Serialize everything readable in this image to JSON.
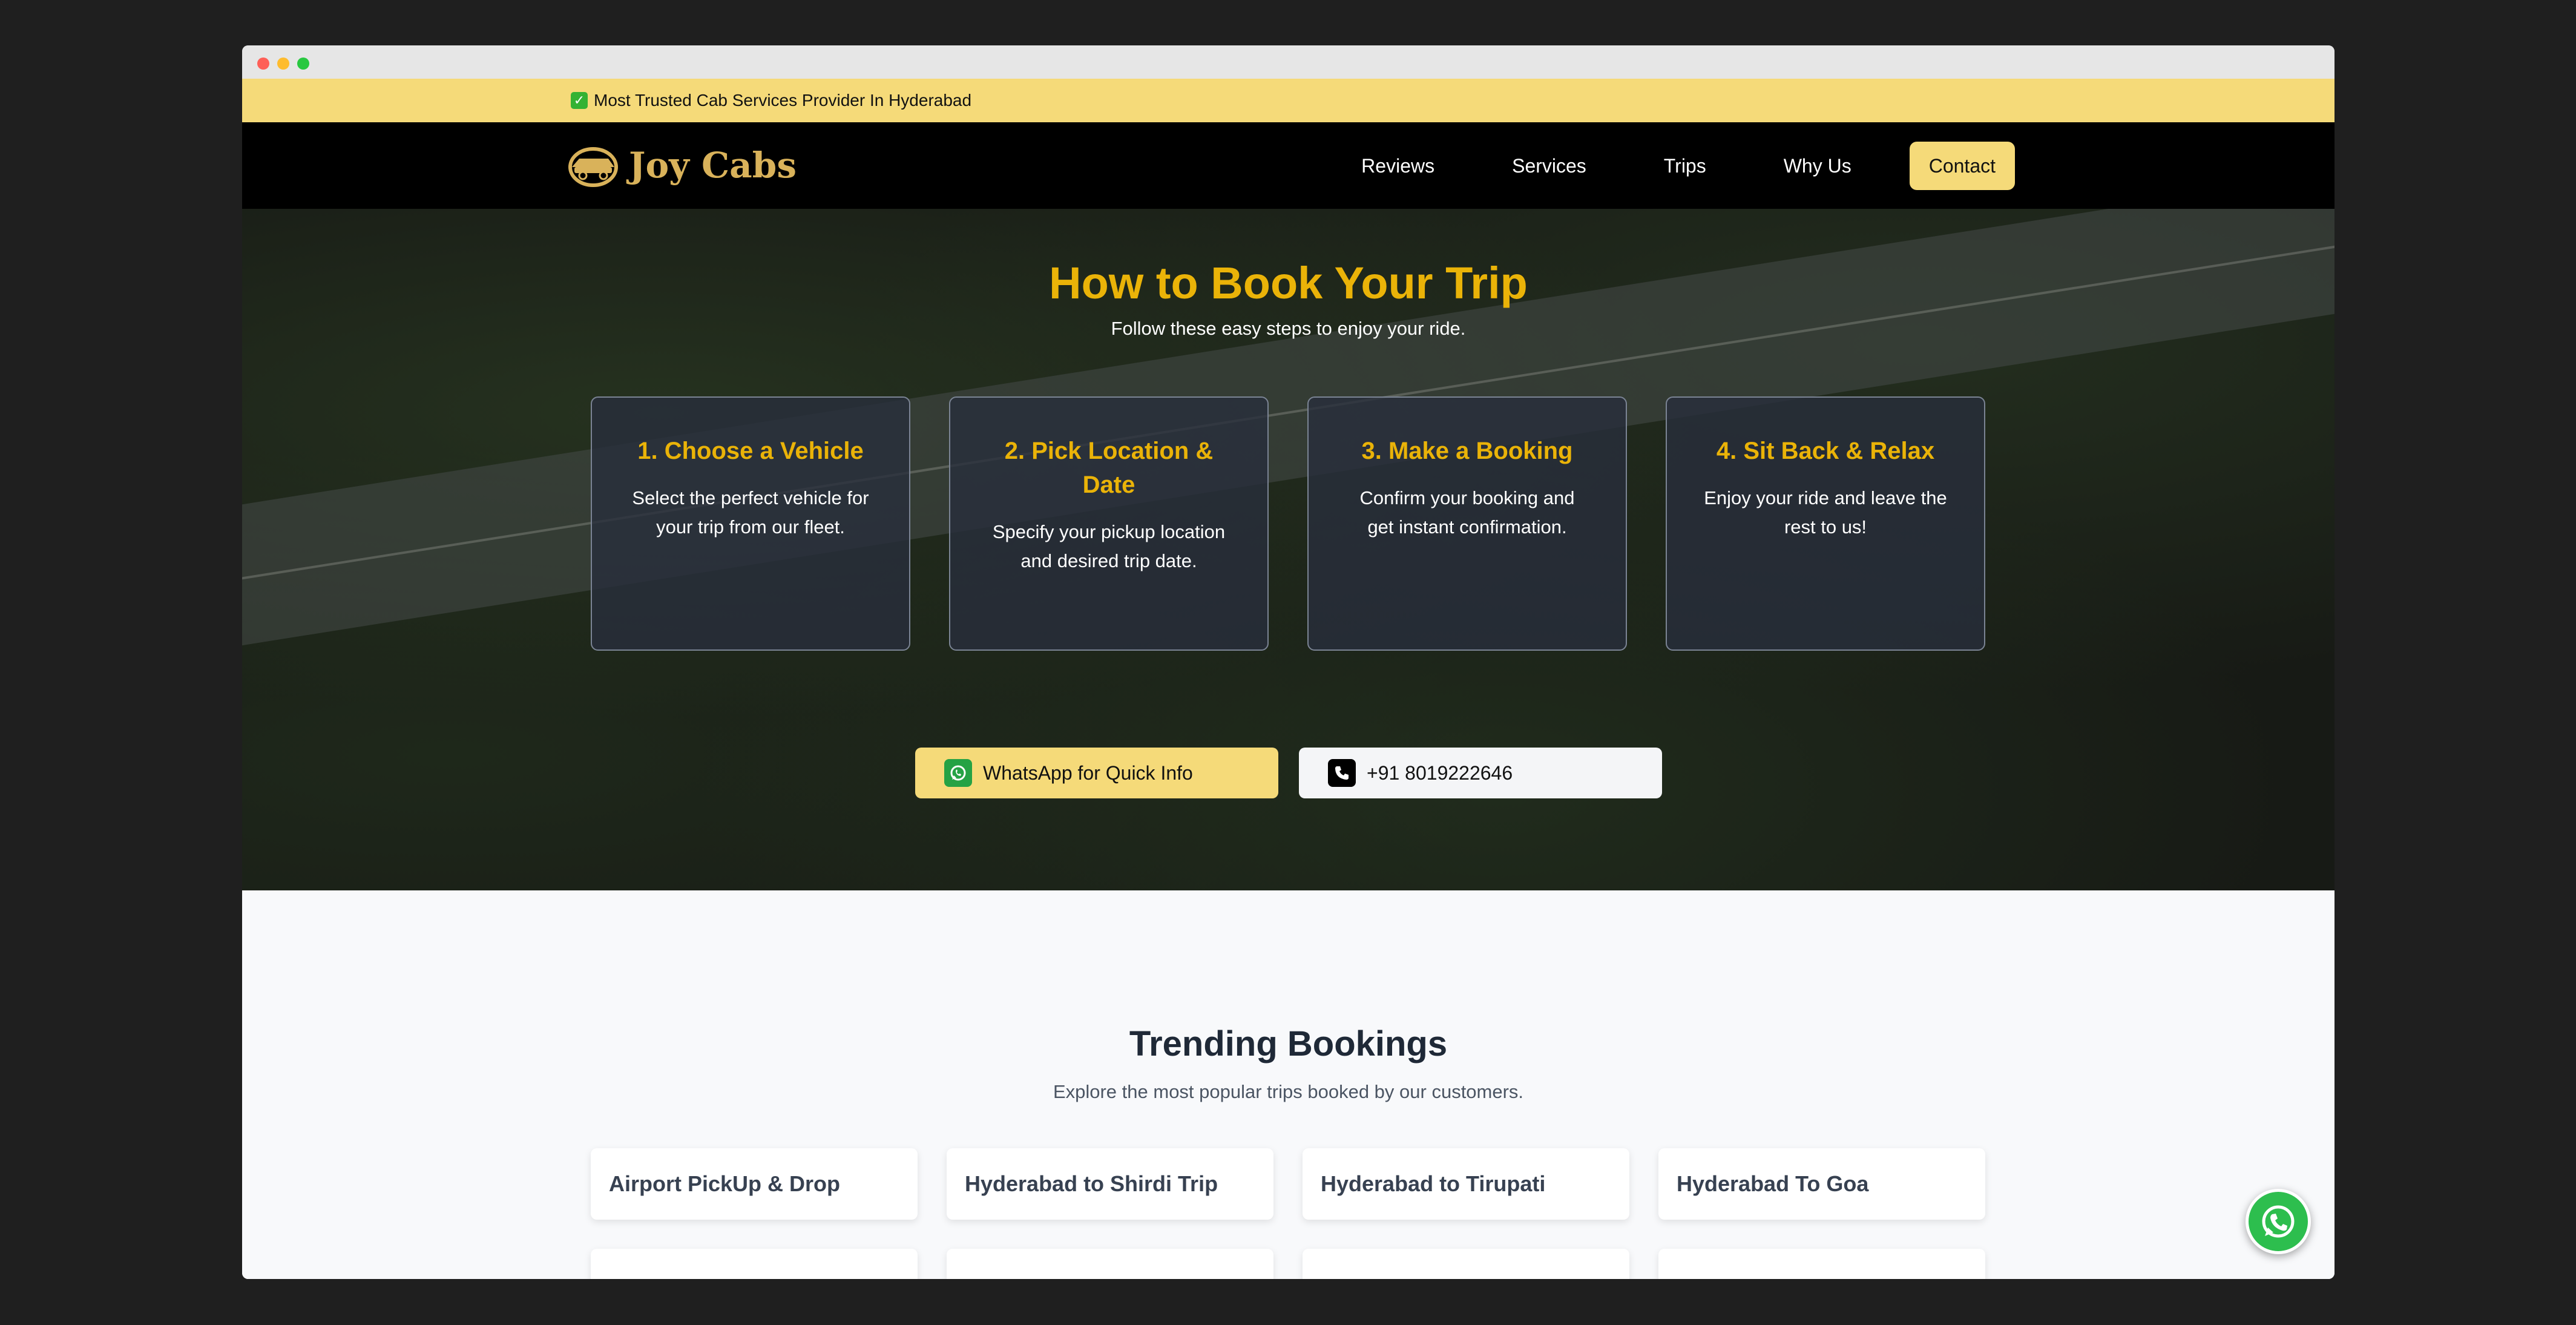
{
  "topbar": {
    "check_icon": "check-icon",
    "text": "Most Trusted Cab Services Provider In Hyderabad"
  },
  "brand": {
    "name": "Joy Cabs",
    "color": "#d9b25a"
  },
  "nav": {
    "links": [
      "Reviews",
      "Services",
      "Trips",
      "Why Us"
    ],
    "contact": "Contact"
  },
  "hero": {
    "title": "How to Book Your Trip",
    "subtitle": "Follow these easy steps to enjoy your ride.",
    "steps": [
      {
        "title": "1. Choose a Vehicle",
        "desc": "Select the perfect vehicle for your trip from our fleet."
      },
      {
        "title": "2. Pick Location & Date",
        "desc": "Specify your pickup location and desired trip date."
      },
      {
        "title": "3. Make a Booking",
        "desc": "Confirm your booking and get instant confirmation."
      },
      {
        "title": "4. Sit Back & Relax",
        "desc": "Enjoy your ride and leave the rest to us!"
      }
    ],
    "whatsapp_label": "WhatsApp for Quick Info",
    "phone_label": "+91 8019222646"
  },
  "trending": {
    "title": "Trending Bookings",
    "subtitle": "Explore the most popular trips booked by our customers.",
    "cards": [
      "Airport PickUp & Drop",
      "Hyderabad to Shirdi Trip",
      "Hyderabad to Tirupati",
      "Hyderabad To Goa"
    ]
  },
  "colors": {
    "accent": "#eab308",
    "topbar": "#f5da79",
    "whatsapp": "#25a244"
  }
}
